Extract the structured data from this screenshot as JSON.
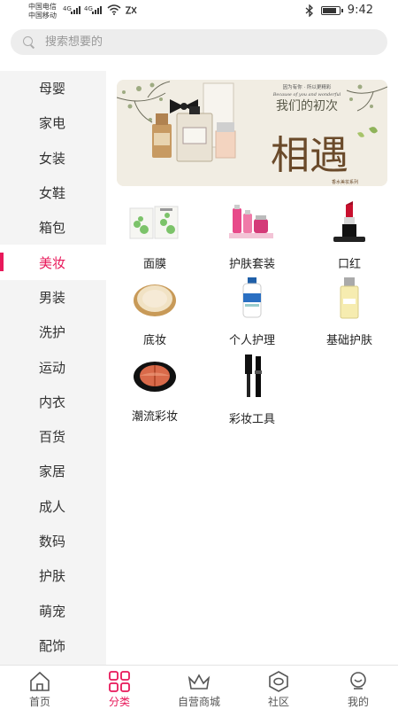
{
  "status_bar": {
    "carrier_1": "中国电信",
    "carrier_2": "中国移动",
    "net_1": "4G",
    "net_2": "4G",
    "time": "9:42",
    "icons": [
      "signal-icon",
      "wifi-icon",
      "bluetooth-icon",
      "battery-icon"
    ]
  },
  "search": {
    "placeholder": "搜索想要的",
    "icon": "search-icon"
  },
  "sidebar": {
    "active_index": 5,
    "items": [
      {
        "label": "母婴"
      },
      {
        "label": "家电"
      },
      {
        "label": "女装"
      },
      {
        "label": "女鞋"
      },
      {
        "label": "箱包"
      },
      {
        "label": "美妆"
      },
      {
        "label": "男装"
      },
      {
        "label": "洗护"
      },
      {
        "label": "运动"
      },
      {
        "label": "内衣"
      },
      {
        "label": "百货"
      },
      {
        "label": "家居"
      },
      {
        "label": "成人"
      },
      {
        "label": "数码"
      },
      {
        "label": "护肤"
      },
      {
        "label": "萌宠"
      },
      {
        "label": "配饰"
      }
    ]
  },
  "banner": {
    "tagline": "因为有你 · 所以更精彩",
    "tagline_en": "Because of you and wonderful",
    "headline": "我们的初次",
    "big_text": "相遇",
    "caption": "香水美妆系列"
  },
  "categories": [
    {
      "label": "面膜",
      "icon": "facial-mask-icon"
    },
    {
      "label": "护肤套装",
      "icon": "skincare-set-icon"
    },
    {
      "label": "口红",
      "icon": "lipstick-icon"
    },
    {
      "label": "底妆",
      "icon": "cushion-compact-icon"
    },
    {
      "label": "个人护理",
      "icon": "lotion-bottle-icon"
    },
    {
      "label": "基础护肤",
      "icon": "moisturizer-bottle-icon"
    },
    {
      "label": "潮流彩妆",
      "icon": "blush-compact-icon"
    },
    {
      "label": "彩妆工具",
      "icon": "mascara-icon"
    }
  ],
  "tabbar": {
    "active_index": 1,
    "tabs": [
      {
        "label": "首页",
        "icon": "home-icon"
      },
      {
        "label": "分类",
        "icon": "category-grid-icon"
      },
      {
        "label": "自营商城",
        "icon": "crown-icon"
      },
      {
        "label": "社区",
        "icon": "hexagon-community-icon"
      },
      {
        "label": "我的",
        "icon": "profile-face-icon"
      }
    ]
  },
  "colors": {
    "accent": "#e8185a",
    "sidebar_bg": "#f4f4f4",
    "search_bg": "#ededed"
  }
}
